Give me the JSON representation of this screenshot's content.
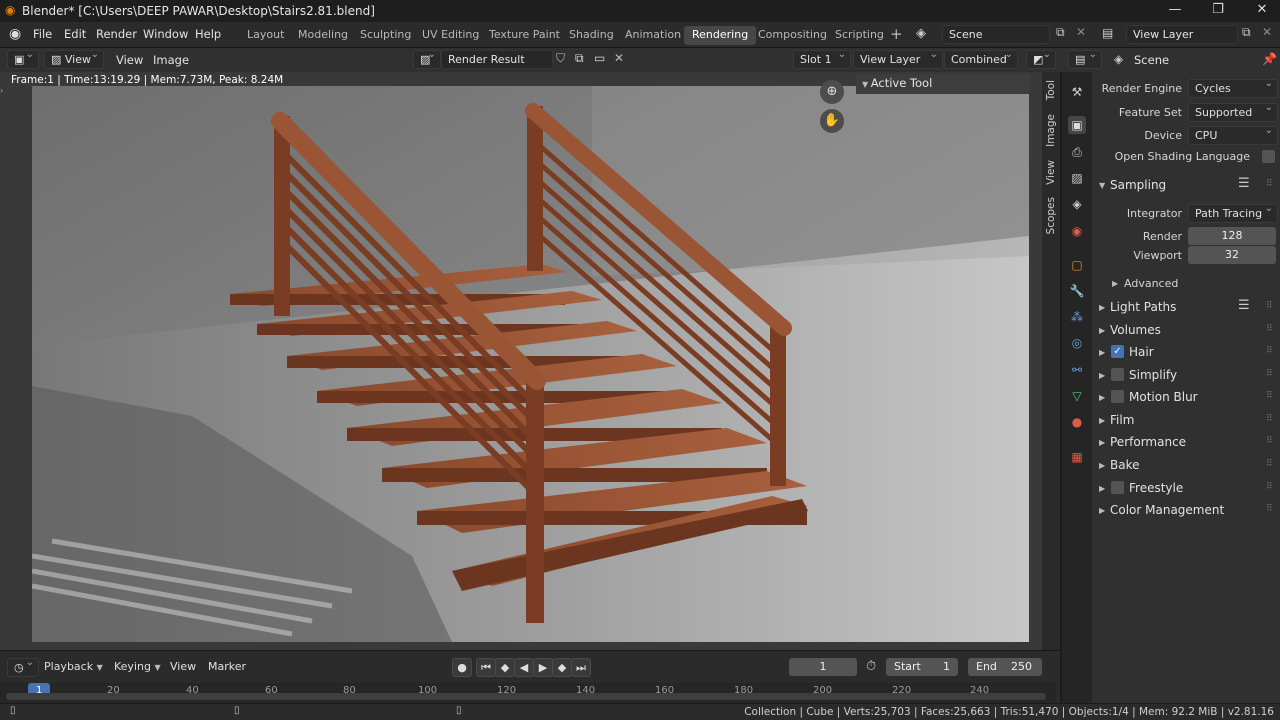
{
  "title": "Blender* [C:\\Users\\DEEP PAWAR\\Desktop\\Stairs2.81.blend]",
  "menu": [
    "File",
    "Edit",
    "Render",
    "Window",
    "Help"
  ],
  "workspaces": [
    "Layout",
    "Modeling",
    "Sculpting",
    "UV Editing",
    "Texture Paint",
    "Shading",
    "Animation",
    "Rendering",
    "Compositing",
    "Scripting"
  ],
  "active_workspace": "Rendering",
  "scene": "Scene",
  "view_layer": "View Layer",
  "image_editor": {
    "view_menu": "View",
    "menus": [
      "View",
      "Image"
    ],
    "image_name": "Render Result",
    "slot": "Slot 1",
    "layer": "View Layer",
    "pass": "Combined",
    "frame_info": "Frame:1 | Time:13:19.29 | Mem:7.73M, Peak: 8.24M",
    "active_tool": "Active Tool",
    "side_tabs": [
      "Tool",
      "Image",
      "View",
      "Scopes"
    ]
  },
  "properties": {
    "header": "Scene",
    "render_engine_label": "Render Engine",
    "render_engine": "Cycles",
    "feature_set_label": "Feature Set",
    "feature_set": "Supported",
    "device_label": "Device",
    "device": "CPU",
    "osl": "Open Shading Language",
    "sampling": "Sampling",
    "integrator_label": "Integrator",
    "integrator": "Path Tracing",
    "render_label": "Render",
    "render_samples": "128",
    "viewport_label": "Viewport",
    "viewport_samples": "32",
    "advanced": "Advanced",
    "panels": [
      "Light Paths",
      "Volumes",
      "Hair",
      "Simplify",
      "Motion Blur",
      "Film",
      "Performance",
      "Bake",
      "Freestyle",
      "Color Management"
    ]
  },
  "timeline": {
    "menus": [
      "Playback",
      "Keying",
      "View",
      "Marker"
    ],
    "current_frame": "1",
    "start_label": "Start",
    "start": "1",
    "end_label": "End",
    "end": "250",
    "ticks": [
      "1",
      "20",
      "40",
      "60",
      "80",
      "100",
      "120",
      "140",
      "160",
      "180",
      "200",
      "220",
      "240"
    ]
  },
  "status": "Collection | Cube | Verts:25,703 | Faces:25,663 | Tris:51,470 | Objects:1/4 | Mem: 92.2 MiB | v2.81.16",
  "colors": {
    "accent": "#4772b3",
    "wood": "#7a4128",
    "wood_light": "#a0583a",
    "floor": "#9a9a9a"
  }
}
